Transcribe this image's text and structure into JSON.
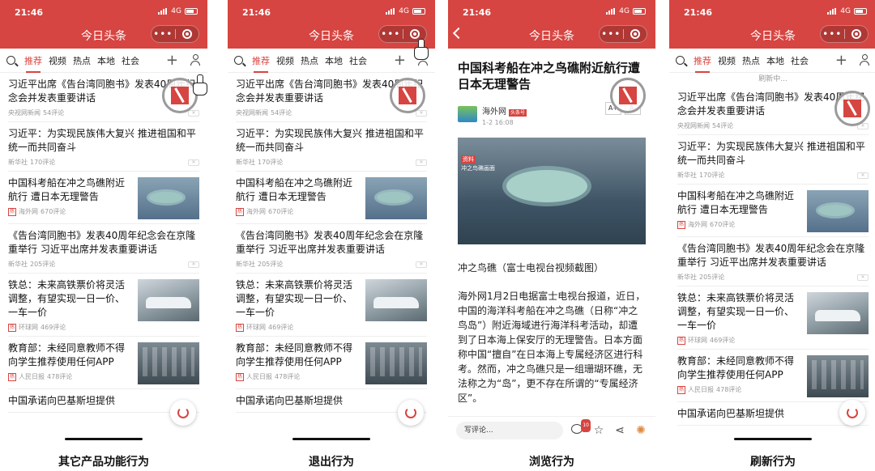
{
  "status": {
    "time": "21:46",
    "network": "4G"
  },
  "header": {
    "title": "今日头条",
    "menu_dots": "•••"
  },
  "tabs": [
    "推荐",
    "视频",
    "热点",
    "本地",
    "社会"
  ],
  "feed": [
    {
      "title": "习近平出席《告台湾同胞书》发表40周年纪念会并发表重要讲话",
      "source": "央视网新闻",
      "comments": "54评论",
      "hot": false,
      "thumb": ""
    },
    {
      "title": "习近平：为实现民族伟大复兴 推进祖国和平统一而共同奋斗",
      "source": "新华社",
      "comments": "170评论",
      "hot": false,
      "thumb": ""
    },
    {
      "title": "中国科考船在冲之鸟礁附近航行 遭日本无理警告",
      "source": "海外网",
      "comments": "670评论",
      "hot": true,
      "thumb": "island"
    },
    {
      "title": "《告台湾同胞书》发表40周年纪念会在京隆重举行 习近平出席并发表重要讲话",
      "source": "新华社",
      "comments": "205评论",
      "hot": false,
      "thumb": ""
    },
    {
      "title": "铁总：未来高铁票价将灵活调整，有望实现一日一价、一车一价",
      "source": "环球网",
      "comments": "469评论",
      "hot": true,
      "thumb": "train"
    },
    {
      "title": "教育部：未经同意教师不得向学生推荐使用任何APP",
      "source": "人民日报",
      "comments": "478评论",
      "hot": true,
      "thumb": "station"
    },
    {
      "title": "中国承诺向巴基斯坦提供",
      "source": "",
      "comments": "",
      "hot": false,
      "thumb": ""
    }
  ],
  "hot_label": "热",
  "x_label": "✕",
  "refreshing": "刷新中...",
  "article": {
    "title": "中国科考船在冲之鸟礁附近航行遭日本无理警告",
    "author": "海外网",
    "author_badge": "头条号",
    "date": "1-2 16:08",
    "font_large": "A+",
    "font_small": "A-",
    "video_tag": "资料",
    "video_sub": "冲之鸟礁画面",
    "caption": "冲之鸟礁（富士电视台视频截图）",
    "body": "海外网1月2日电据富士电视台报道，近日，中国的海洋科考船在冲之鸟礁（日称“冲之鸟岛”）附近海域进行海洋科考活动，却遭到了日本海上保安厅的无理警告。日本方面称中国“擅自”在日本海上专属经济区进行科考。然而，冲之鸟礁只是一组珊瑚环礁，无法称之为“岛”，更不存在所谓的“专属经济区”。",
    "write_comment": "写评论...",
    "comment_count": "10"
  },
  "labels": [
    "其它产品功能行为",
    "退出行为",
    "浏览行为",
    "刷新行为"
  ],
  "colors": {
    "brand_red": "#d64541"
  }
}
